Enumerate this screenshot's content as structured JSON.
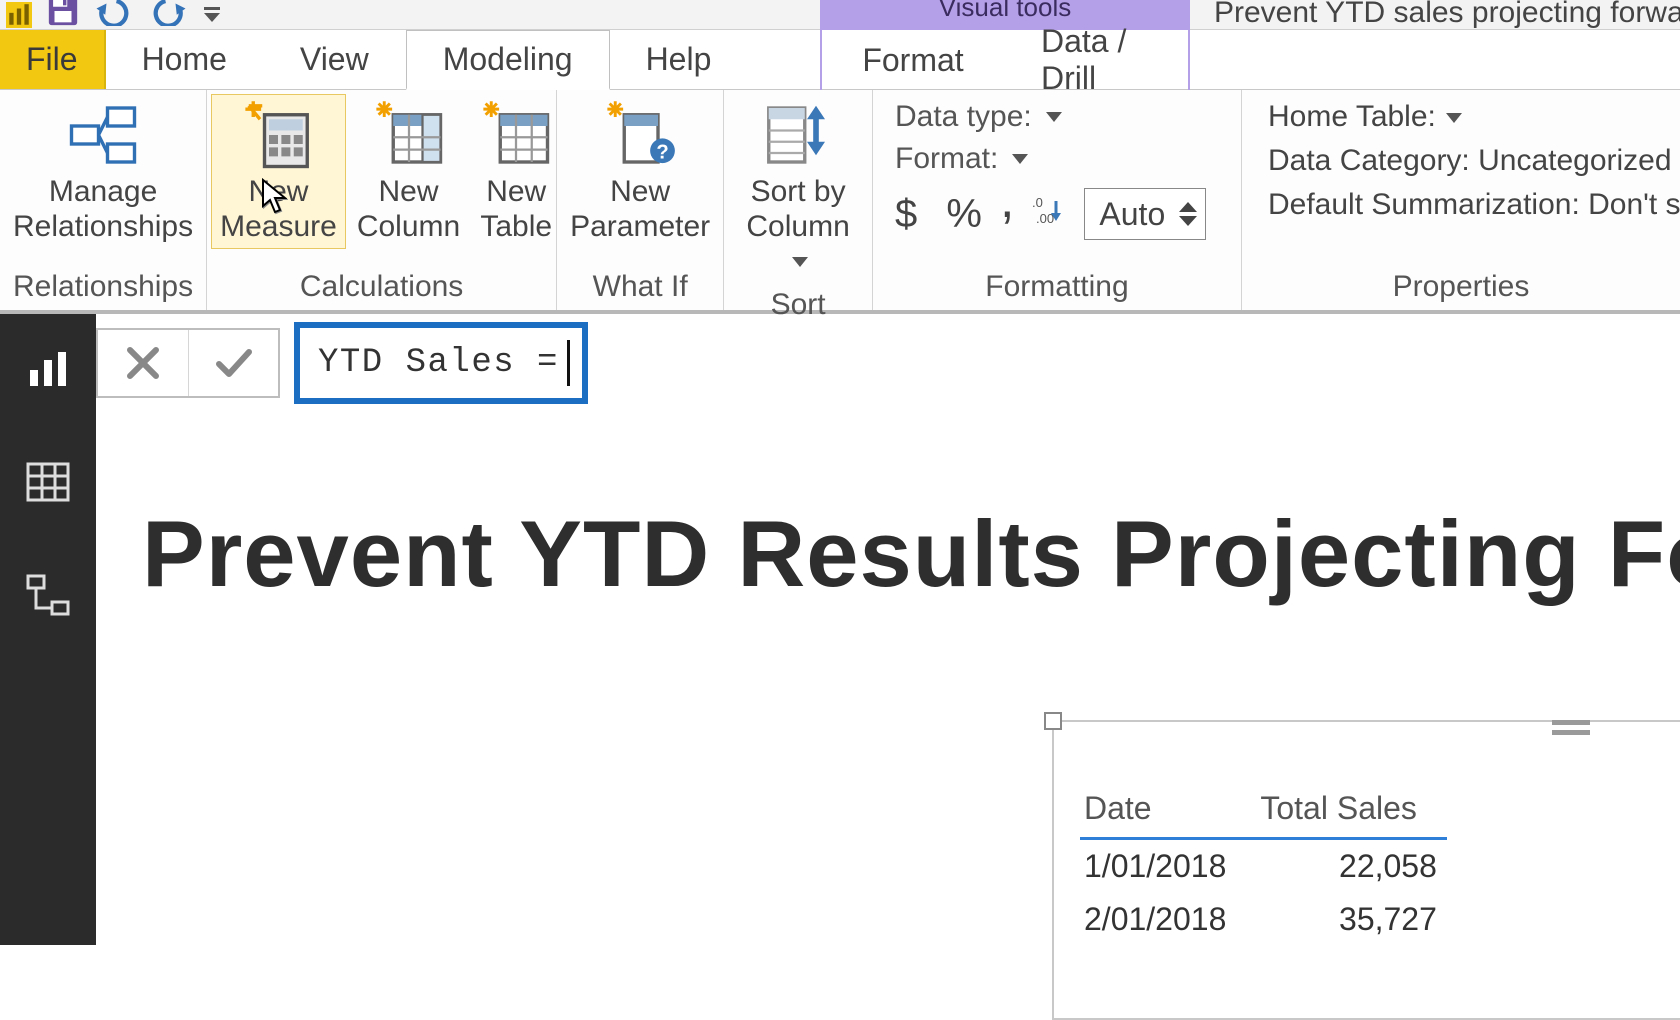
{
  "titlebar": {
    "contextual_label": "Visual tools",
    "window_title": "Prevent YTD sales projecting forward"
  },
  "tabs": {
    "file": "File",
    "home": "Home",
    "view": "View",
    "modeling": "Modeling",
    "help": "Help",
    "format": "Format",
    "data_drill": "Data / Drill"
  },
  "ribbon": {
    "relationships": {
      "manage": "Manage\nRelationships",
      "group": "Relationships"
    },
    "calculations": {
      "new_measure": "New\nMeasure",
      "new_column": "New\nColumn",
      "new_table": "New\nTable",
      "group": "Calculations"
    },
    "whatif": {
      "new_parameter": "New\nParameter",
      "group": "What If"
    },
    "sort": {
      "sort_by": "Sort by\nColumn",
      "group": "Sort"
    },
    "formatting": {
      "data_type_label": "Data type:",
      "format_label": "Format:",
      "currency_symbol": "$",
      "percent_symbol": "%",
      "thousands_symbol": ",",
      "decimals_symbol": ".00",
      "auto_value": "Auto",
      "group": "Formatting"
    },
    "properties": {
      "home_table": "Home Table:",
      "data_category": "Data Category: Uncategorized",
      "default_summarization": "Default Summarization: Don't s",
      "group": "Properties"
    }
  },
  "formula": {
    "text": "YTD Sales ="
  },
  "canvas": {
    "title": "Prevent YTD Results Projecting Forw"
  },
  "table_visual": {
    "columns": [
      "Date",
      "Total Sales"
    ],
    "rows": [
      {
        "date": "1/01/2018",
        "sales": "22,058"
      },
      {
        "date": "2/01/2018",
        "sales": "35,727"
      }
    ]
  }
}
